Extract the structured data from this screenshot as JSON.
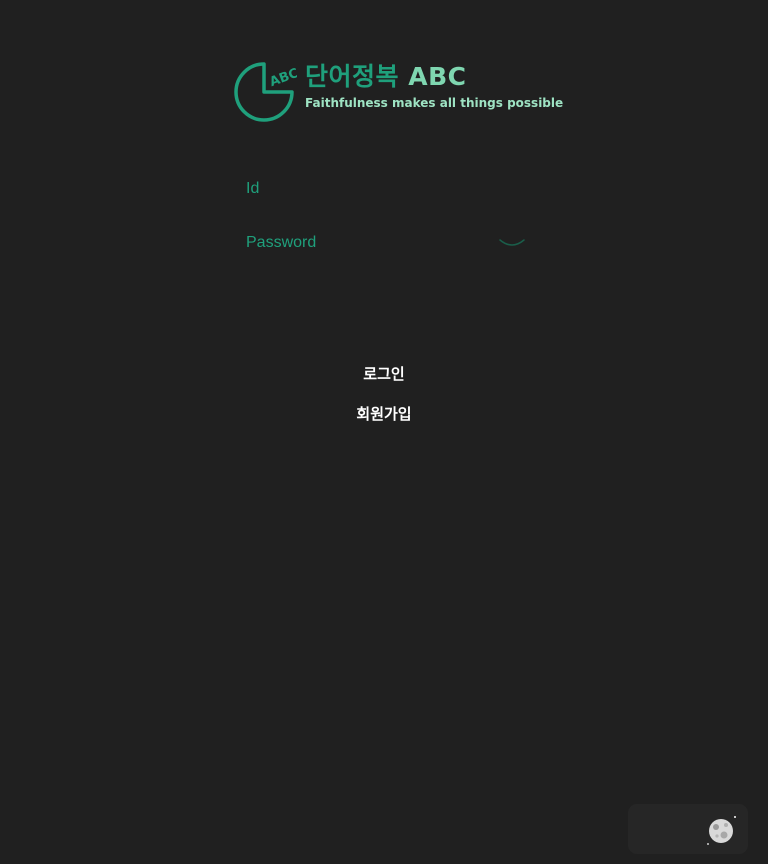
{
  "logo": {
    "mark_text": "ABC",
    "title": "단어정복",
    "title_abc": "ABC",
    "tagline": "Faithfulness makes all things possible"
  },
  "form": {
    "id_placeholder": "Id",
    "password_placeholder": "Password",
    "id_value": "",
    "password_value": ""
  },
  "buttons": {
    "login": "로그인",
    "signup": "회원가입"
  },
  "theme_toggle": {
    "icon": "moon-icon",
    "mode": "dark"
  },
  "colors": {
    "background": "#202020",
    "accent": "#1fa07c",
    "accent_light": "#7fd6b0",
    "button_text": "#ffffff"
  }
}
